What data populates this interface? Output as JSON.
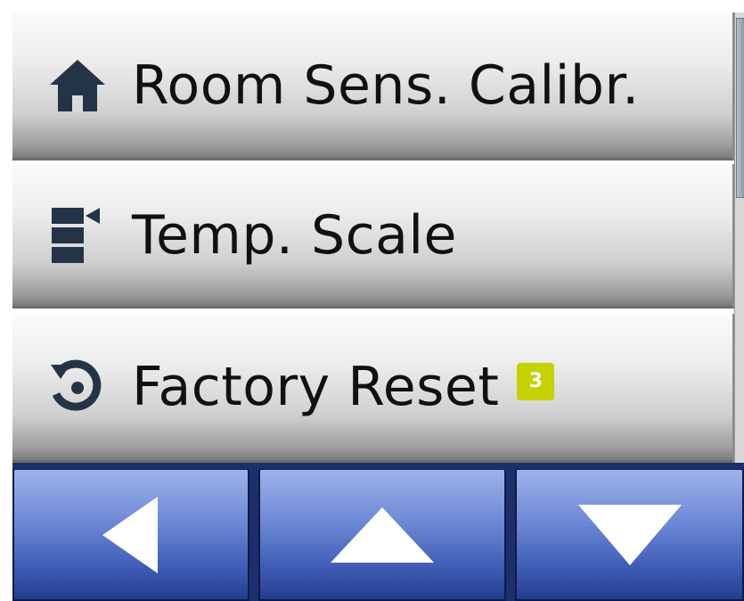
{
  "menu": {
    "items": [
      {
        "label": "Room Sens. Calibr.",
        "icon": "home-icon"
      },
      {
        "label": "Temp. Scale",
        "icon": "temp-scale-icon"
      },
      {
        "label": "Factory Reset",
        "icon": "reset-icon",
        "badge": "3"
      }
    ]
  },
  "navbar": {
    "buttons": [
      {
        "icon": "arrow-left-icon"
      },
      {
        "icon": "arrow-up-icon"
      },
      {
        "icon": "arrow-down-icon"
      }
    ]
  },
  "colors": {
    "icon": "#253346",
    "badge": "#c4d200",
    "nav_button": "#3f5db6",
    "nav_bar": "#1c2f6d"
  }
}
